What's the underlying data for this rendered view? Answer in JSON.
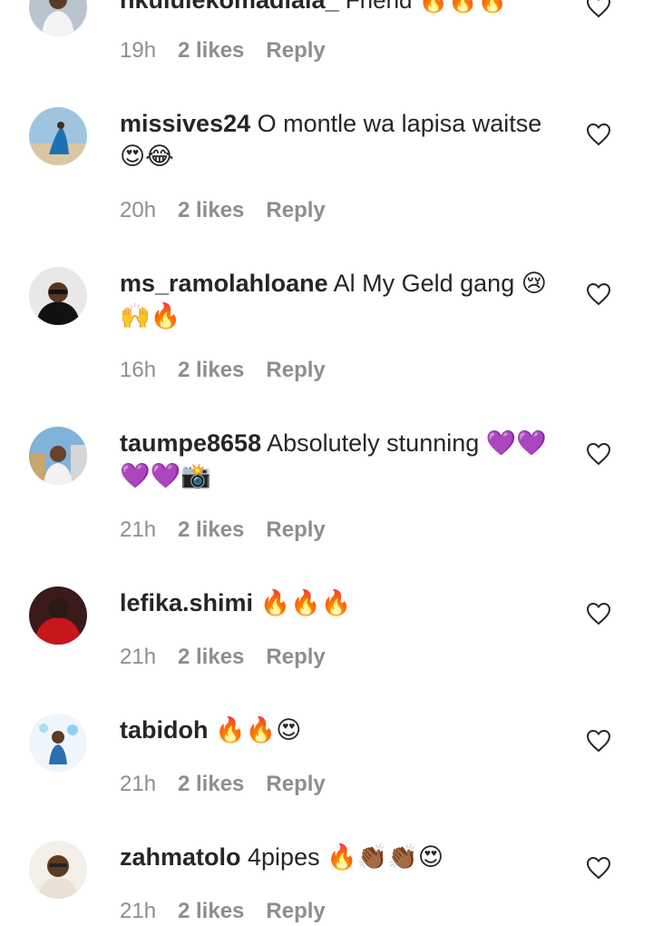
{
  "comments": [
    {
      "username": "nkululekomadlala_",
      "text": " Friend 🔥🔥🔥",
      "time": "19h",
      "likes": "2 likes",
      "reply": "Reply",
      "avatar": "avatar-person-white-outfit"
    },
    {
      "username": "missives24",
      "text": " O montle wa lapisa waitse 😍😂",
      "time": "20h",
      "likes": "2 likes",
      "reply": "Reply",
      "avatar": "avatar-beach-blue-dress"
    },
    {
      "username": "ms_ramolahloane",
      "text": " Al My Geld gang 😢🙌🔥",
      "time": "16h",
      "likes": "2 likes",
      "reply": "Reply",
      "avatar": "avatar-woman-sunglasses"
    },
    {
      "username": "taumpe8658",
      "text": " Absolutely stunning 💜💜💜💜📸",
      "time": "21h",
      "likes": "2 likes",
      "reply": "Reply",
      "avatar": "avatar-city-portrait"
    },
    {
      "username": "lefika.shimi",
      "text": " 🔥🔥🔥",
      "time": "21h",
      "likes": "2 likes",
      "reply": "Reply",
      "avatar": "avatar-red-hoodie"
    },
    {
      "username": "tabidoh",
      "text": " 🔥🔥😍",
      "time": "21h",
      "likes": "2 likes",
      "reply": "Reply",
      "avatar": "avatar-child-balloons"
    },
    {
      "username": "zahmatolo",
      "text": " 4pipes 🔥👏🏾👏🏾😍",
      "time": "21h",
      "likes": "2 likes",
      "reply": "Reply",
      "avatar": "avatar-woman-glasses"
    }
  ],
  "icons": {
    "like": "heart-icon"
  },
  "colors": {
    "text": "#262626",
    "meta": "#8e8e8e"
  }
}
